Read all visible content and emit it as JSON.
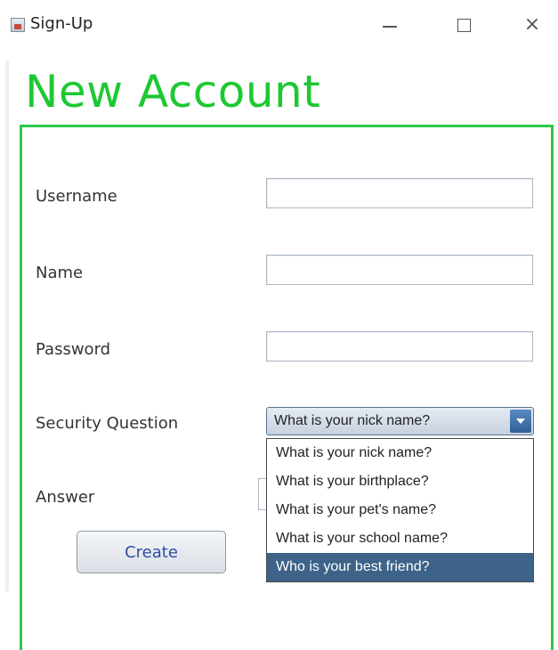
{
  "window": {
    "title": "Sign-Up",
    "app_icon": "java-coffee-cup-icon"
  },
  "titlebar_controls": {
    "minimize_icon": "minimize-icon",
    "maximize_icon": "maximize-icon",
    "close_icon": "close-icon",
    "close_glyph": "×"
  },
  "form": {
    "heading": "New Account",
    "heading_color": "#1ec832",
    "border_color": "#2fc84a",
    "fields": {
      "username_label": "Username",
      "username_value": "",
      "name_label": "Name",
      "name_value": "",
      "password_label": "Password",
      "password_value": "",
      "security_label": "Security Question",
      "answer_label": "Answer",
      "answer_value": ""
    },
    "security_question": {
      "selected": "What is your nick name?",
      "options": [
        "What is your nick name?",
        "What is your birthplace?",
        "What is your pet's name?",
        "What is your school name?",
        "Who is your best friend?"
      ],
      "highlighted_option": "Who is your best friend?",
      "highlight_color": "#3d6389"
    },
    "create_label": "Create",
    "create_text_color": "#2d4fa0"
  }
}
